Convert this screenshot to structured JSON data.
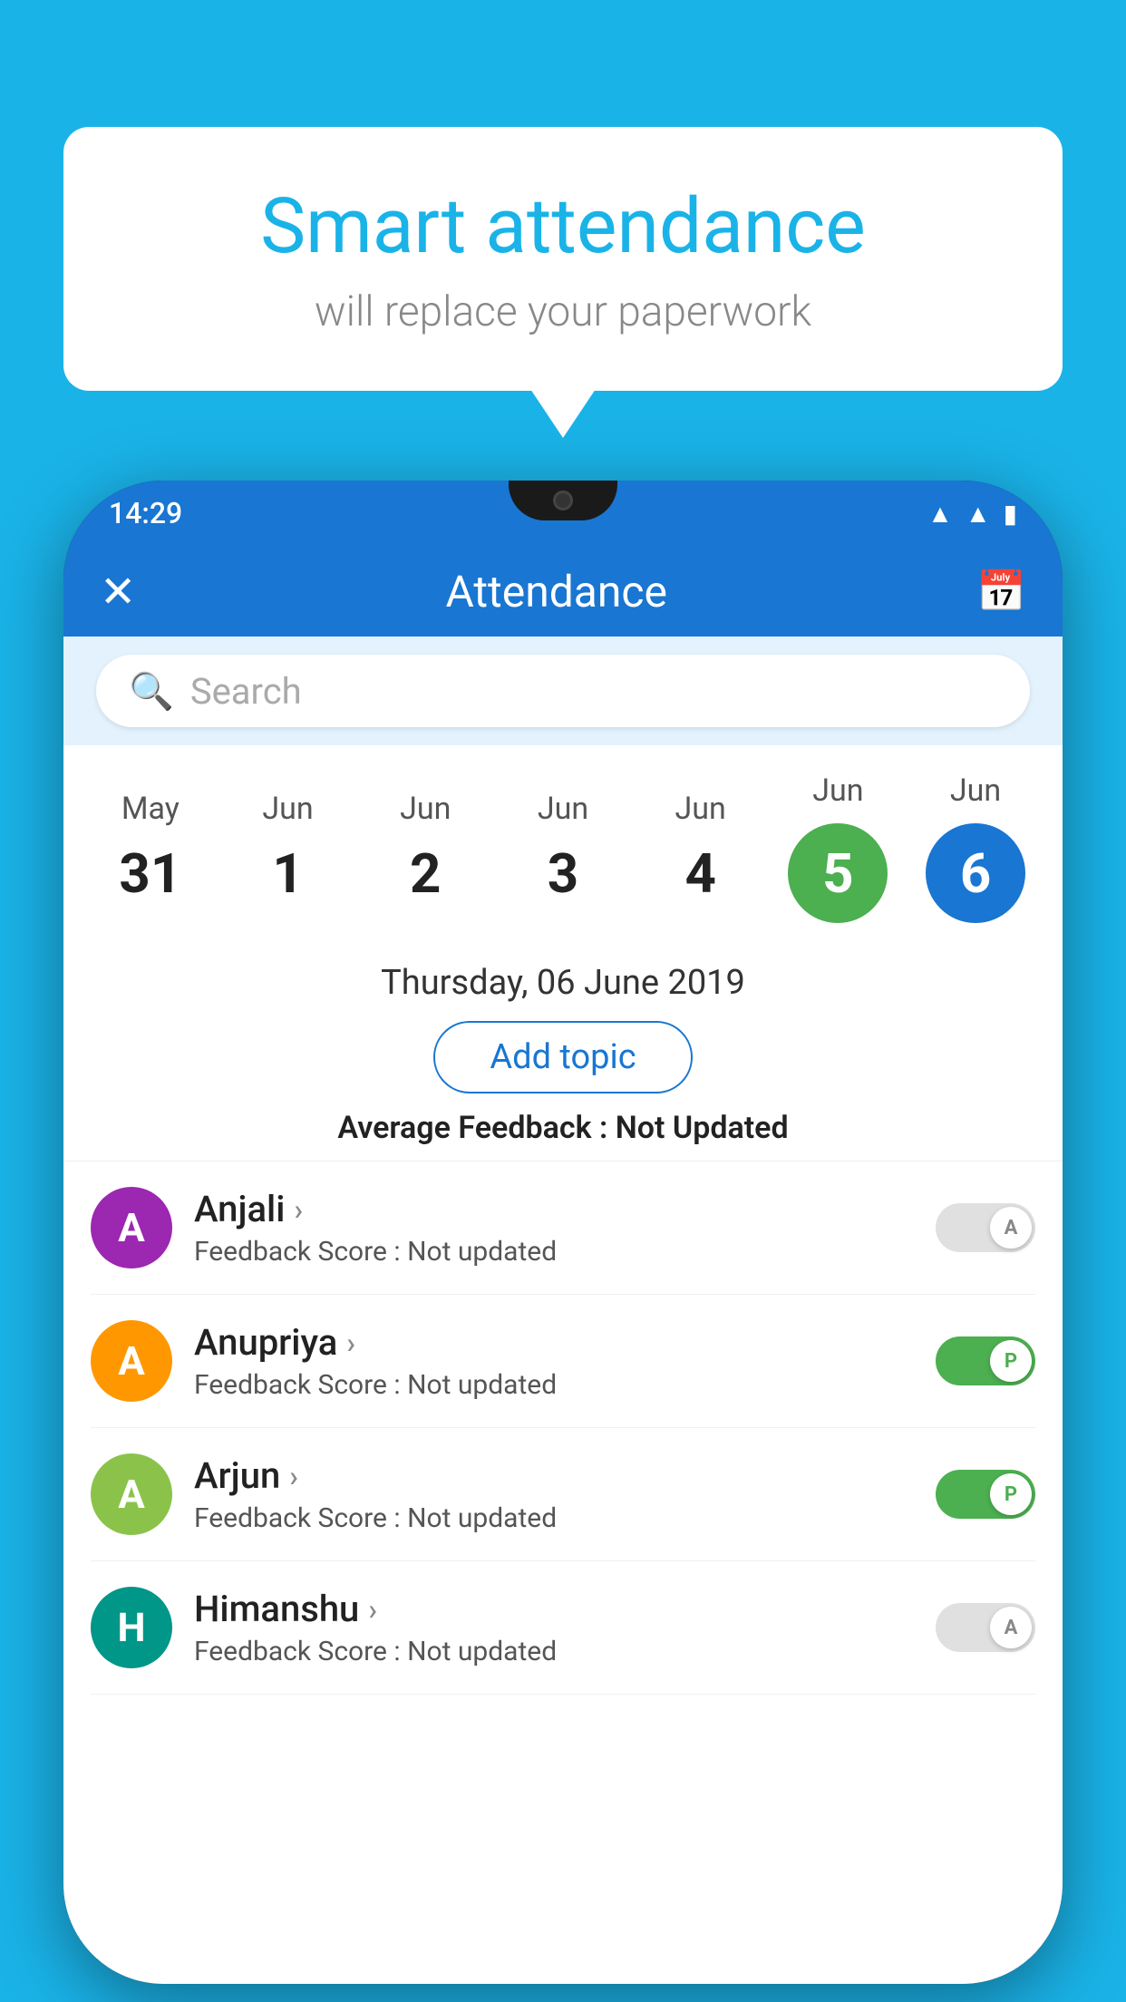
{
  "background_color": "#1ab3e8",
  "speech_bubble": {
    "title": "Smart attendance",
    "subtitle": "will replace your paperwork"
  },
  "status_bar": {
    "time": "14:29",
    "wifi_icon": "▲",
    "signal_icon": "▲",
    "battery_icon": "▮"
  },
  "app_bar": {
    "close_icon": "✕",
    "title": "Attendance",
    "calendar_icon": "📅"
  },
  "search": {
    "placeholder": "Search"
  },
  "calendar": {
    "days": [
      {
        "month": "May",
        "day": "31",
        "highlight": false
      },
      {
        "month": "Jun",
        "day": "1",
        "highlight": false
      },
      {
        "month": "Jun",
        "day": "2",
        "highlight": false
      },
      {
        "month": "Jun",
        "day": "3",
        "highlight": false
      },
      {
        "month": "Jun",
        "day": "4",
        "highlight": false
      },
      {
        "month": "Jun",
        "day": "5",
        "highlight": "green"
      },
      {
        "month": "Jun",
        "day": "6",
        "highlight": "blue"
      }
    ]
  },
  "selected_date": "Thursday, 06 June 2019",
  "add_topic_label": "Add topic",
  "average_feedback": {
    "label": "Average Feedback : ",
    "value": "Not Updated"
  },
  "students": [
    {
      "name": "Anjali",
      "avatar_letter": "A",
      "avatar_color": "purple",
      "feedback_label": "Feedback Score : ",
      "feedback_value": "Not updated",
      "status": "absent",
      "status_letter": "A"
    },
    {
      "name": "Anupriya",
      "avatar_letter": "A",
      "avatar_color": "orange",
      "feedback_label": "Feedback Score : ",
      "feedback_value": "Not updated",
      "status": "present",
      "status_letter": "P"
    },
    {
      "name": "Arjun",
      "avatar_letter": "A",
      "avatar_color": "lightgreen",
      "feedback_label": "Feedback Score : ",
      "feedback_value": "Not updated",
      "status": "present",
      "status_letter": "P"
    },
    {
      "name": "Himanshu",
      "avatar_letter": "H",
      "avatar_color": "teal",
      "feedback_label": "Feedback Score : ",
      "feedback_value": "Not updated",
      "status": "absent",
      "status_letter": "A"
    }
  ]
}
